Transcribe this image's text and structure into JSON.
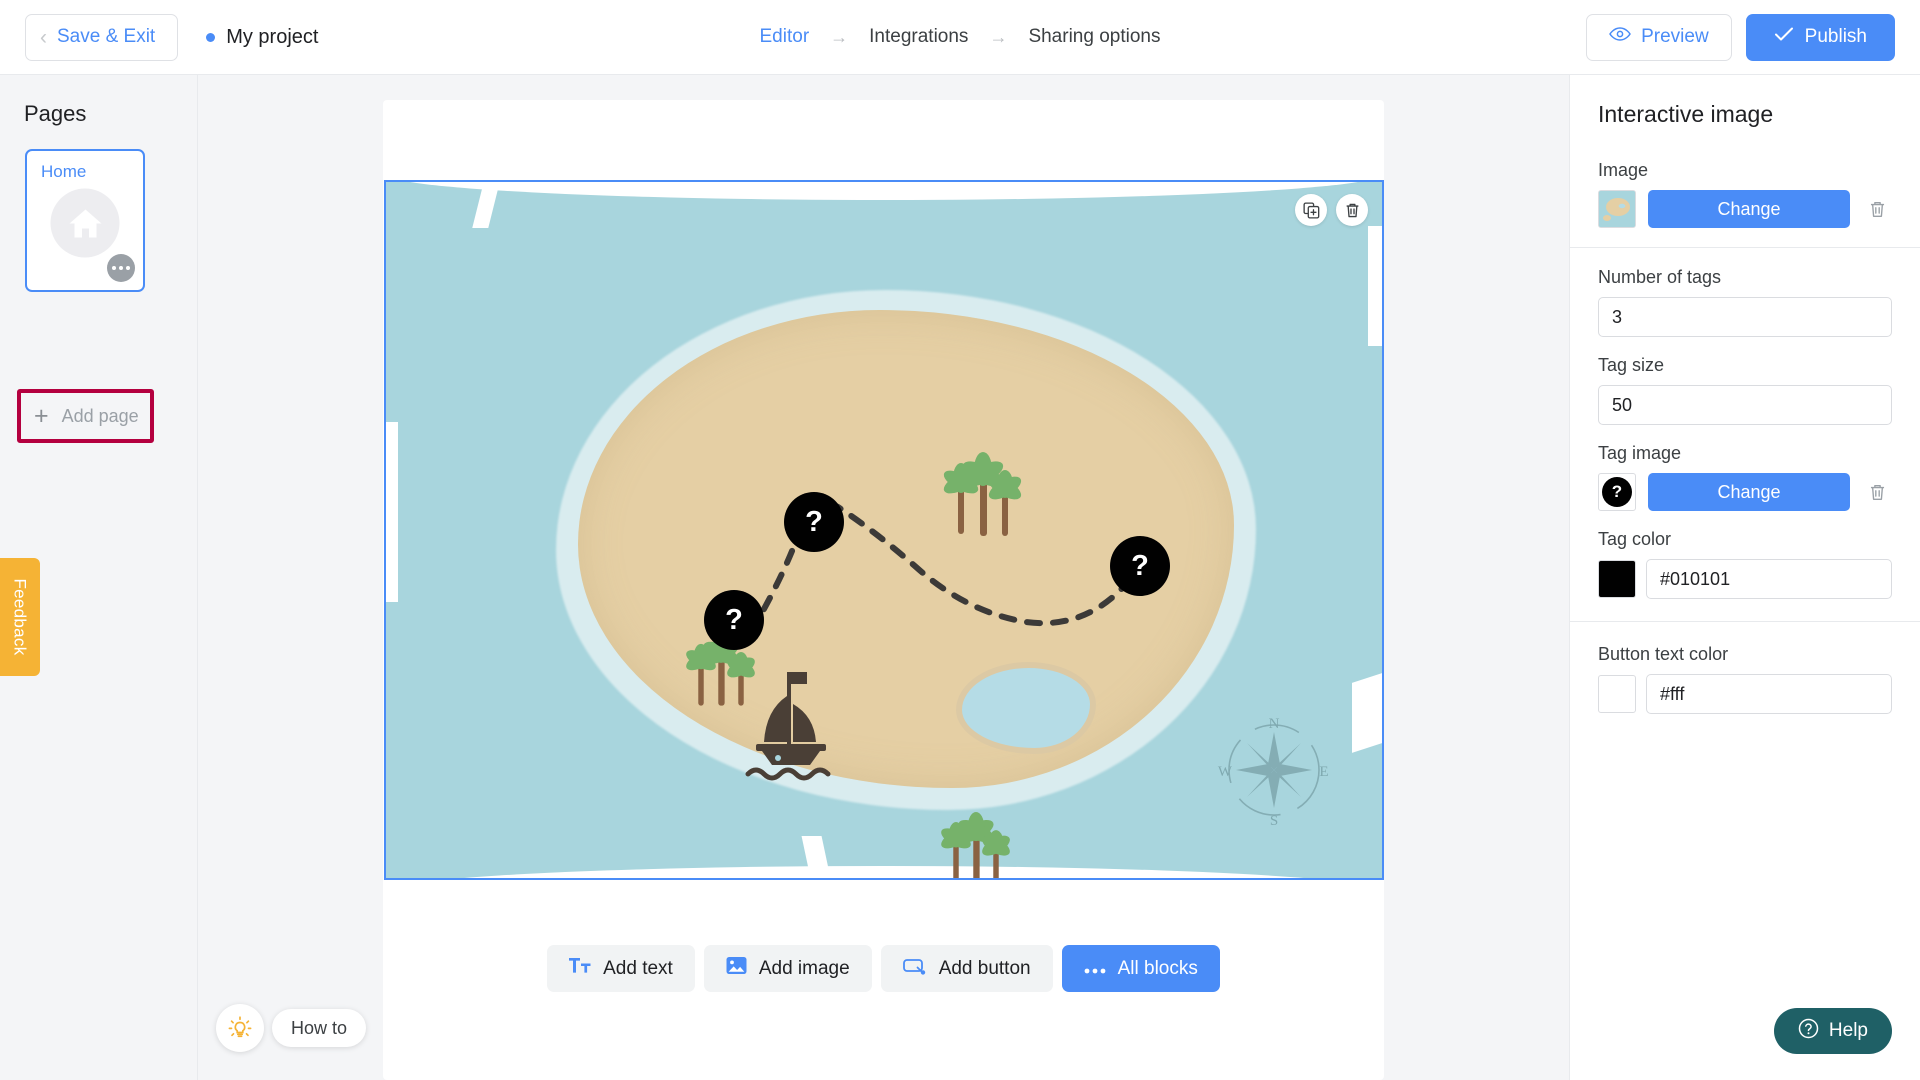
{
  "header": {
    "save_exit_label": "Save & Exit",
    "project_name": "My project",
    "breadcrumbs": [
      {
        "label": "Editor",
        "active": true
      },
      {
        "label": "Integrations",
        "active": false
      },
      {
        "label": "Sharing options",
        "active": false
      }
    ],
    "crumb_arrow": "→",
    "preview_label": "Preview",
    "publish_label": "Publish",
    "preview_icon": "eye-icon",
    "publish_icon": "check-icon",
    "back_chevron_icon": "chevron-left-icon"
  },
  "sidebar": {
    "title": "Pages",
    "pages": [
      {
        "label": "Home",
        "icon": "home-icon",
        "selected": true
      }
    ],
    "add_page_label": "Add page",
    "add_page_icon": "plus-icon",
    "more_icon": "ellipsis-icon",
    "highlight_color": "#b4003f",
    "feedback_label": "Feedback",
    "feedback_color": "#f5b335"
  },
  "canvas": {
    "block_actions": [
      {
        "name": "duplicate-block-button",
        "icon": "duplicate-icon"
      },
      {
        "name": "delete-block-button",
        "icon": "trash-icon"
      }
    ],
    "map": {
      "water_color": "#a8d5dd",
      "sand_color": "#e5cfa4",
      "shore_color": "#d9ecef",
      "lagoon_color": "#b5dce6",
      "compass_labels": {
        "n": "N",
        "e": "E",
        "s": "S",
        "w": "W"
      },
      "tags": [
        {
          "label": "?",
          "name": "image-tag-1"
        },
        {
          "label": "?",
          "name": "image-tag-2"
        },
        {
          "label": "?",
          "name": "image-tag-3"
        }
      ]
    },
    "toolbar": [
      {
        "label": "Add text",
        "icon": "text-icon",
        "primary": false,
        "name": "add-text-button"
      },
      {
        "label": "Add image",
        "icon": "image-icon",
        "primary": false,
        "name": "add-image-button"
      },
      {
        "label": "Add button",
        "icon": "button-icon",
        "primary": false,
        "name": "add-button-button"
      },
      {
        "label": "All blocks",
        "icon": "ellipsis-icon",
        "primary": true,
        "name": "all-blocks-button"
      }
    ],
    "howto_label": "How to",
    "howto_icon": "lightbulb-icon"
  },
  "properties": {
    "title": "Interactive image",
    "image": {
      "label": "Image",
      "change_label": "Change",
      "delete_icon": "trash-icon",
      "thumbnail": "treasure-map-thumbnail"
    },
    "number_of_tags": {
      "label": "Number of tags",
      "value": "3"
    },
    "tag_size": {
      "label": "Tag size",
      "value": "50"
    },
    "tag_image": {
      "label": "Tag image",
      "change_label": "Change",
      "delete_icon": "trash-icon",
      "thumbnail_glyph": "?"
    },
    "tag_color": {
      "label": "Tag color",
      "value": "#010101",
      "swatch": "#010101"
    },
    "button_text_color": {
      "label": "Button text color",
      "value": "#fff",
      "swatch": "#ffffff"
    }
  },
  "help": {
    "label": "Help",
    "icon": "question-circle-icon",
    "color": "#1f6066"
  }
}
